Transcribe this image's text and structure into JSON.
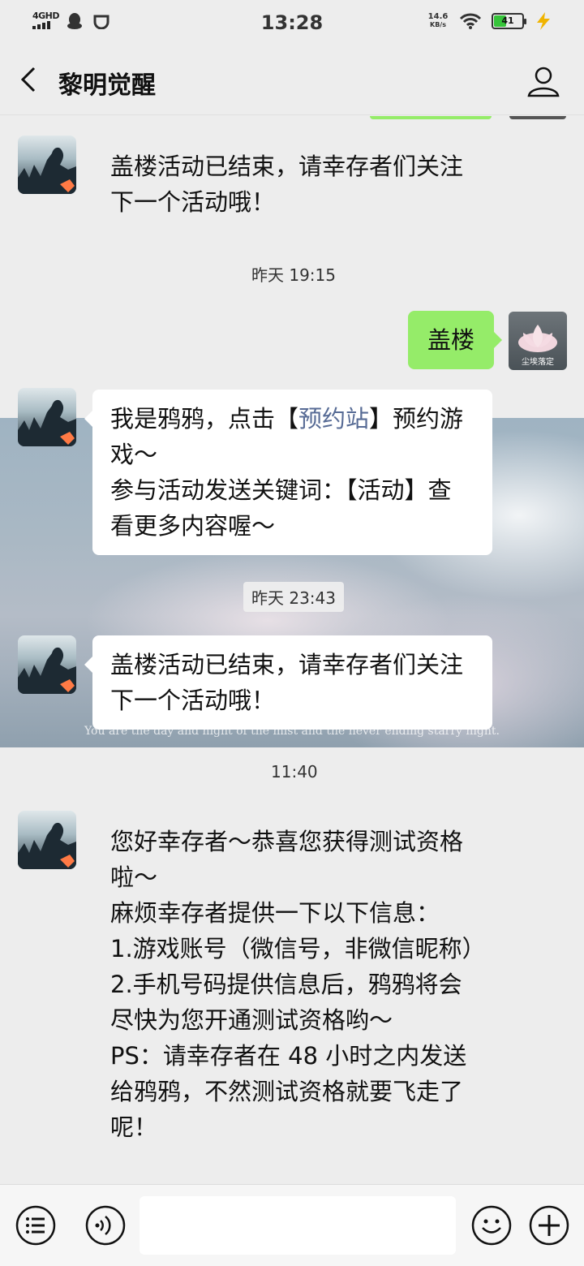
{
  "status_bar": {
    "network": "4GHD",
    "time": "13:28",
    "speed_value": "14.6",
    "speed_unit": "KB/s",
    "battery": "41",
    "battery_level": 0.41
  },
  "header": {
    "title": "黎明觉醒"
  },
  "chat": {
    "messages": [
      {
        "lines": [
          "盖楼活动已结束，请幸存者们关注",
          "下一个活动哦！"
        ]
      },
      {
        "time": "昨天 19:15"
      },
      {
        "text": "盖楼"
      },
      {
        "line1_pre": "我是鸦鸦，点击【",
        "line1_link": "预约站",
        "line1_post": "】预约游",
        "line2": "戏～",
        "line3": "参与活动发送关键词：【活动】查",
        "line4": "看更多内容喔～"
      },
      {
        "time": "昨天 23:43"
      },
      {
        "lines": [
          "盖楼活动已结束，请幸存者们关注",
          "下一个活动哦！"
        ]
      },
      {
        "time": "11:40"
      },
      {
        "lines": [
          "您好幸存者～恭喜您获得测试资格",
          "啦～",
          "麻烦幸存者提供一下以下信息：",
          "1.游戏账号（微信号，非微信昵称）",
          "2.手机号码提供信息后，鸦鸦将会",
          "尽快为您开通测试资格哟～",
          "PS：请幸存者在 48 小时之内发送",
          "给鸦鸦，不然测试资格就要飞走了",
          "呢！"
        ]
      }
    ],
    "user_avatar_caption": "尘埃落定",
    "background_caption": "You are the day and night of the mist and the never ending starry night."
  },
  "colors": {
    "green_bubble": "#95ec69",
    "link": "#576b95",
    "background": "#ededed"
  }
}
